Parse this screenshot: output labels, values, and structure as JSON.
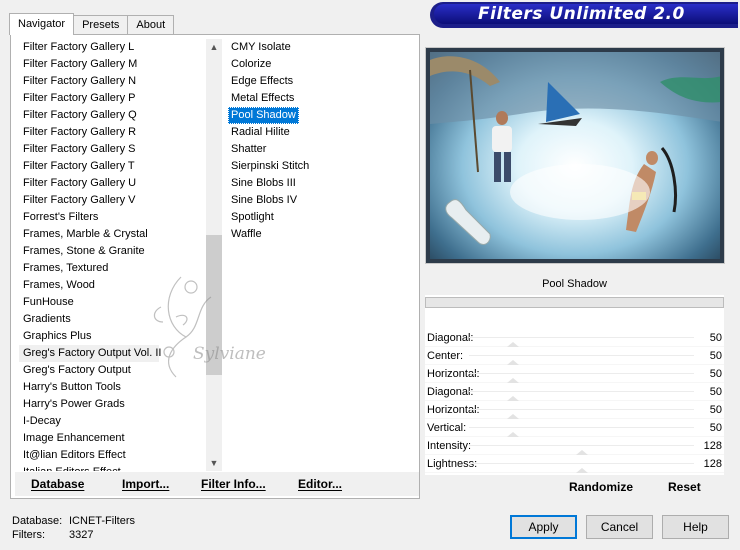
{
  "tabs": [
    {
      "label": "Navigator",
      "active": true
    },
    {
      "label": "Presets",
      "active": false
    },
    {
      "label": "About",
      "active": false
    }
  ],
  "banner_title": "Filters Unlimited 2.0",
  "categories": [
    "Filter Factory Gallery L",
    "Filter Factory Gallery M",
    "Filter Factory Gallery N",
    "Filter Factory Gallery P",
    "Filter Factory Gallery Q",
    "Filter Factory Gallery R",
    "Filter Factory Gallery S",
    "Filter Factory Gallery T",
    "Filter Factory Gallery U",
    "Filter Factory Gallery V",
    "Forrest's Filters",
    "Frames, Marble & Crystal",
    "Frames, Stone & Granite",
    "Frames, Textured",
    "Frames, Wood",
    "FunHouse",
    "Gradients",
    "Graphics Plus",
    "Greg's Factory Output Vol. II",
    "Greg's Factory Output",
    "Harry's Button Tools",
    "Harry's Power Grads",
    "I-Decay",
    "Image Enhancement",
    "It@lian Editors Effect",
    "Italian Editors Effect"
  ],
  "highlighted_category": "Greg's Factory Output Vol. II",
  "filters": [
    "CMY Isolate",
    "Colorize",
    "Edge Effects",
    "Metal Effects",
    "Pool Shadow",
    "Radial Hilite",
    "Shatter",
    "Sierpinski Stitch",
    "Sine Blobs III",
    "Sine Blobs IV",
    "Spotlight",
    "Waffle"
  ],
  "selected_filter": "Pool Shadow",
  "left_buttons": {
    "database": "Database",
    "import": "Import...",
    "filter_info": "Filter Info...",
    "editor": "Editor..."
  },
  "watermark_text": "Sylviane",
  "filter_title": "Pool Shadow",
  "params": [
    {
      "label": "Diagonal:",
      "value": "50"
    },
    {
      "label": "Center:",
      "value": "50"
    },
    {
      "label": "Horizontal:",
      "value": "50"
    },
    {
      "label": "Diagonal:",
      "value": "50"
    },
    {
      "label": "Horizontal:",
      "value": "50"
    },
    {
      "label": "Vertical:",
      "value": "50"
    },
    {
      "label": "Intensity:",
      "value": "128"
    },
    {
      "label": "Lightness:",
      "value": "128"
    }
  ],
  "param_max": 255,
  "right_buttons": {
    "randomize": "Randomize",
    "reset": "Reset"
  },
  "status": {
    "database_label": "Database:",
    "database_value": "ICNET-Filters",
    "filters_label": "Filters:",
    "filters_value": "3327"
  },
  "dialog_buttons": {
    "apply": "Apply",
    "cancel": "Cancel",
    "help": "Help"
  },
  "colors": {
    "banner": "#1c1e8a",
    "selection": "#0078d7"
  }
}
